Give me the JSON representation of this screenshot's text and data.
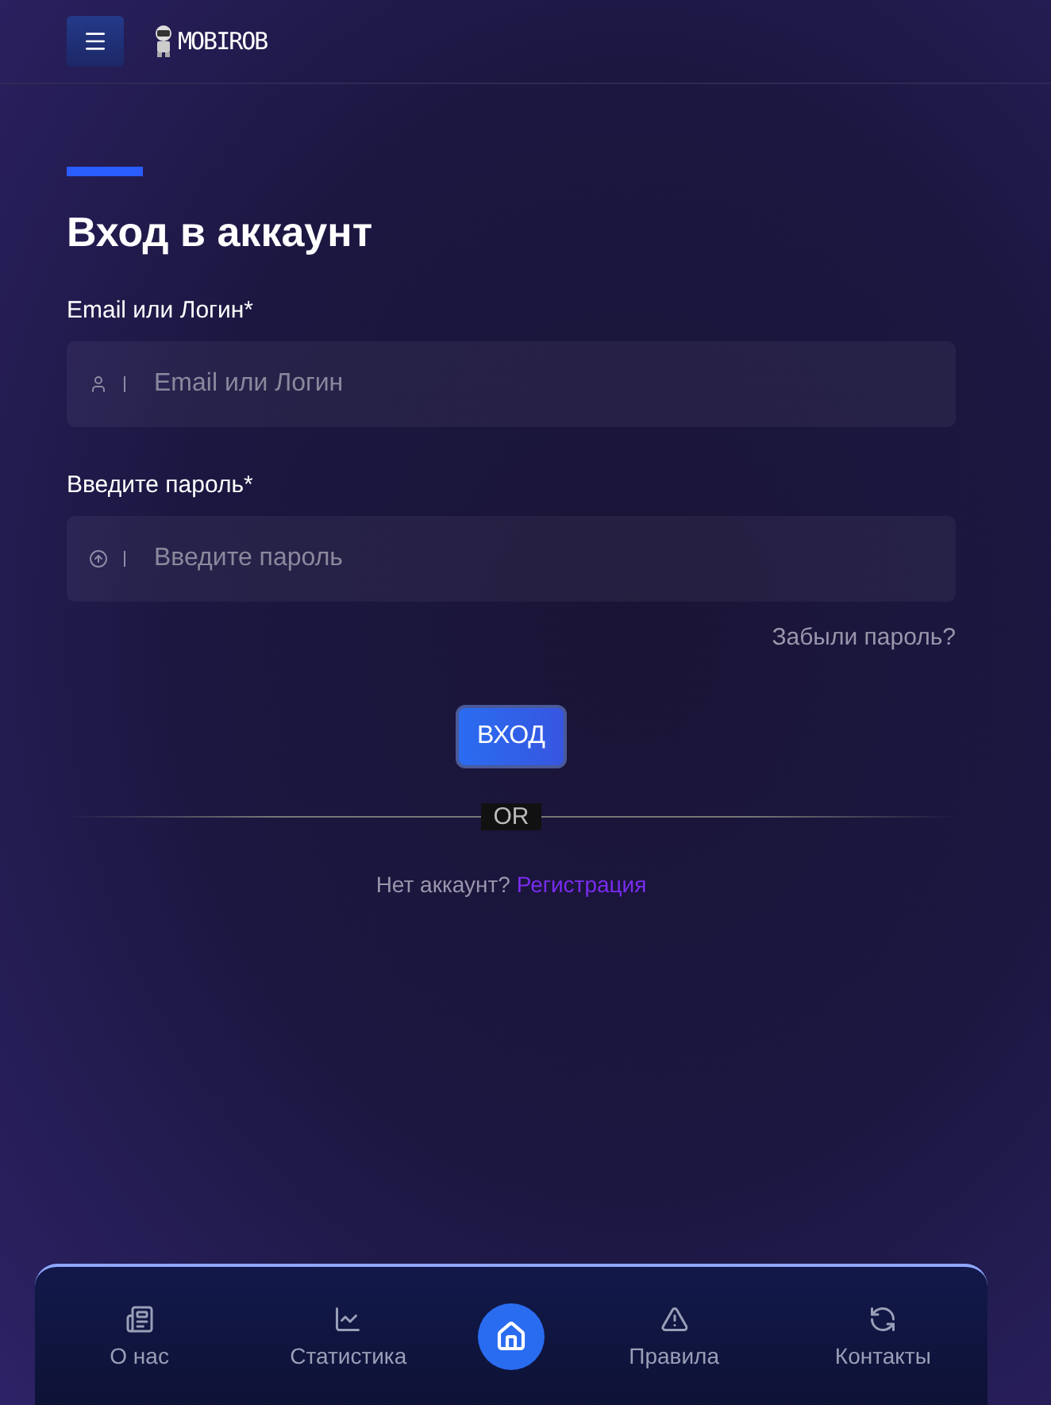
{
  "header": {
    "logo": "MOBIROB"
  },
  "form": {
    "title": "Вход в аккаунт",
    "fields": [
      {
        "label": "Email или Логин*",
        "placeholder": "Email или Логин",
        "kind": "user"
      },
      {
        "label": "Введите пароль*",
        "placeholder": "Введите пароль",
        "kind": "password"
      }
    ],
    "forgot": "Забыли пароль?",
    "submit": "ВХОД",
    "divider": "OR",
    "signup_prompt": "Нет аккаунт?",
    "signup_link": "Регистрация"
  },
  "bottom_nav": [
    {
      "label": "О нас",
      "kind": "news",
      "selected": false
    },
    {
      "label": "Статистика",
      "kind": "chart",
      "selected": false
    },
    {
      "kind": "home",
      "selected": true
    },
    {
      "label": "Правила",
      "kind": "warning",
      "selected": false
    },
    {
      "label": "Контакты",
      "kind": "support",
      "selected": false
    }
  ]
}
